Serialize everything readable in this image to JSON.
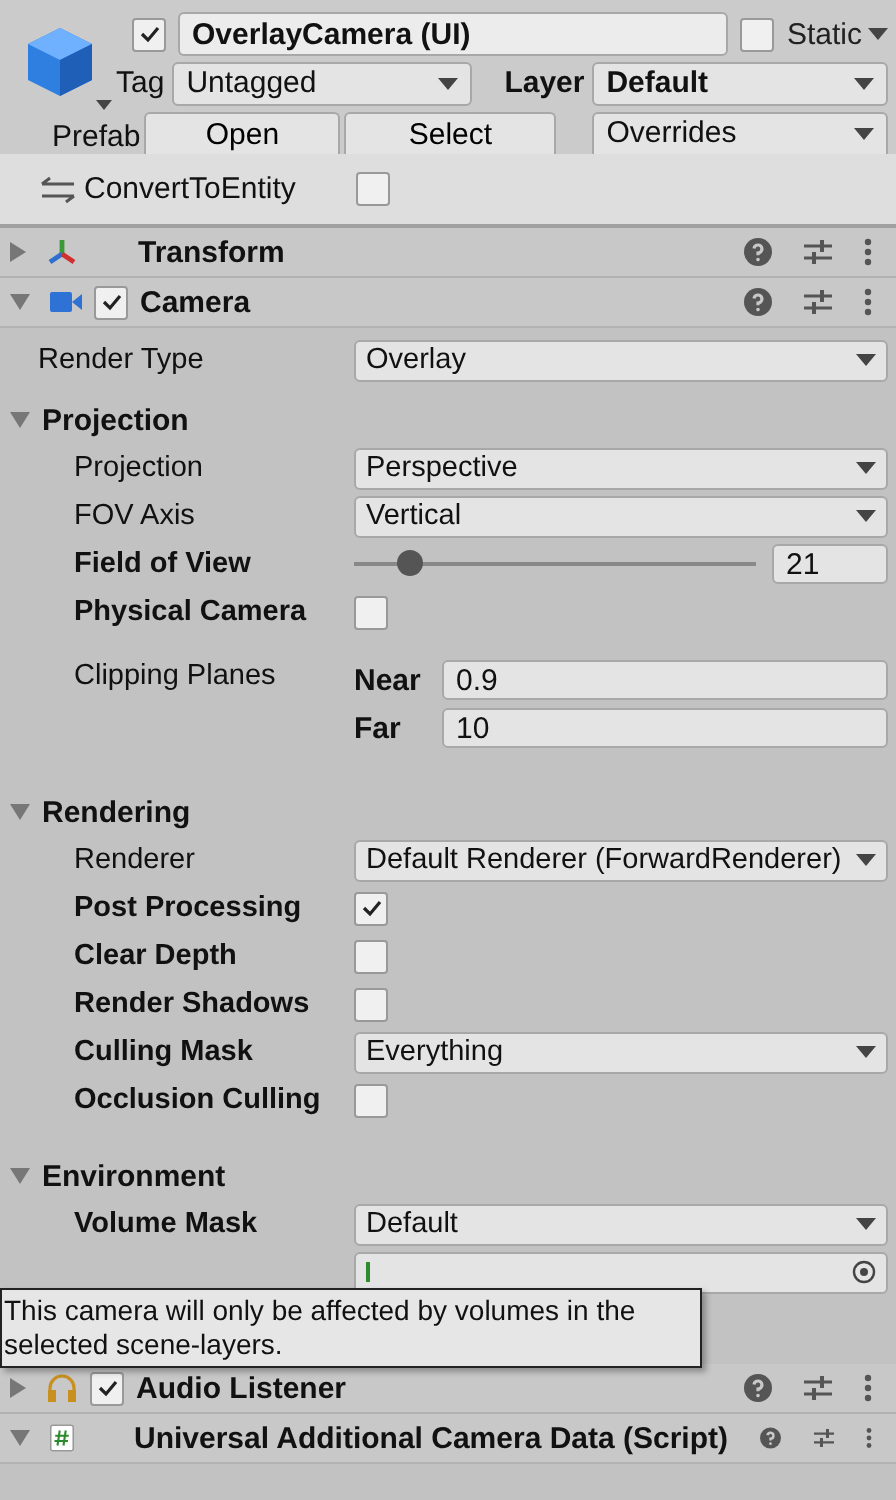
{
  "header": {
    "active": true,
    "name": "OverlayCamera (UI)",
    "static": false,
    "static_label": "Static",
    "tag_label": "Tag",
    "tag": "Untagged",
    "layer_label": "Layer",
    "layer": "Default",
    "prefab_label": "Prefab",
    "prefab_buttons": [
      "Open",
      "Select"
    ],
    "overrides": "Overrides"
  },
  "convert": {
    "label": "ConvertToEntity",
    "checked": false
  },
  "components_top": [
    {
      "kind": "transform",
      "title": "Transform",
      "expanded": false
    },
    {
      "kind": "camera",
      "title": "Camera",
      "expanded": true,
      "enabled": true
    }
  ],
  "camera": {
    "render_type": {
      "label": "Render Type",
      "value": "Overlay"
    },
    "sections": [
      {
        "title": "Projection",
        "expanded": true,
        "rows": [
          {
            "kind": "dropdown",
            "label": "Projection",
            "overridden": false,
            "value": "Perspective"
          },
          {
            "kind": "dropdown",
            "label": "FOV Axis",
            "overridden": false,
            "value": "Vertical"
          },
          {
            "kind": "slider",
            "label": "Field of View",
            "overridden": true,
            "level": 0.14,
            "value": "21"
          },
          {
            "kind": "checkbox",
            "label": "Physical Camera",
            "overridden": true,
            "checked": false
          },
          {
            "kind": "clip",
            "label": "Clipping Planes",
            "overridden": false,
            "near_label": "Near",
            "near": "0.9",
            "far_label": "Far",
            "far": "10"
          }
        ]
      },
      {
        "title": "Rendering",
        "expanded": true,
        "rows": [
          {
            "kind": "dropdown",
            "label": "Renderer",
            "overridden": false,
            "value": "Default Renderer (ForwardRenderer)"
          },
          {
            "kind": "checkbox",
            "label": "Post Processing",
            "overridden": true,
            "checked": true
          },
          {
            "kind": "checkbox",
            "label": "Clear Depth",
            "overridden": true,
            "checked": false
          },
          {
            "kind": "checkbox",
            "label": "Render Shadows",
            "overridden": true,
            "checked": false
          },
          {
            "kind": "dropdown",
            "label": "Culling Mask",
            "overridden": true,
            "value": "Everything"
          },
          {
            "kind": "checkbox",
            "label": "Occlusion Culling",
            "overridden": true,
            "checked": false
          }
        ]
      },
      {
        "title": "Environment",
        "expanded": true,
        "rows": [
          {
            "kind": "dropdown",
            "label": "Volume Mask",
            "overridden": true,
            "value": "Default"
          },
          {
            "kind": "object"
          }
        ]
      }
    ]
  },
  "tooltip": "This camera will only be affected by volumes in the selected scene-layers.",
  "components_bottom": [
    {
      "kind": "audio",
      "title": "Audio Listener",
      "expanded": false,
      "enabled": true
    },
    {
      "kind": "script",
      "title": "Universal Additional Camera Data (Script)",
      "expanded": true
    }
  ]
}
